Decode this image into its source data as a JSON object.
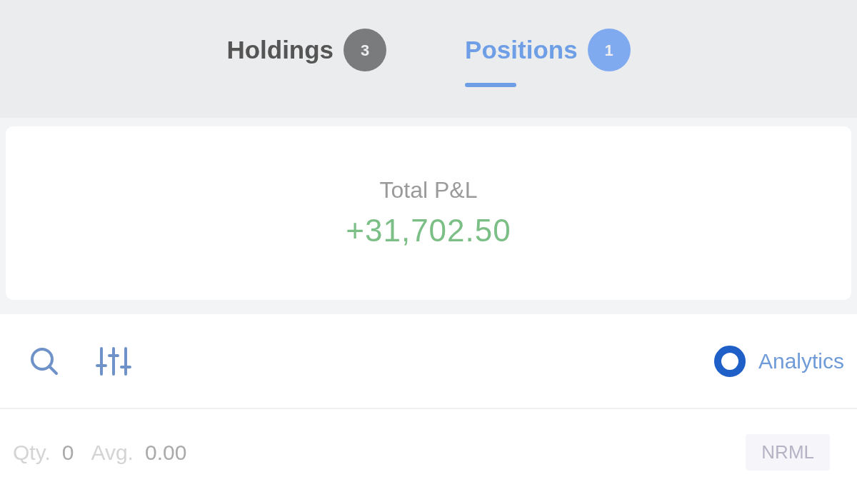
{
  "tabs": [
    {
      "label": "Holdings",
      "count": "3",
      "selected": false
    },
    {
      "label": "Positions",
      "count": "1",
      "selected": true
    }
  ],
  "summary": {
    "label": "Total P&L",
    "value": "+31,702.50"
  },
  "toolbar": {
    "analytics_label": "Analytics"
  },
  "positions": [
    {
      "qty_label": "Qty.",
      "qty": "0",
      "avg_label": "Avg.",
      "avg": "0.00",
      "product": "NRML"
    }
  ]
}
